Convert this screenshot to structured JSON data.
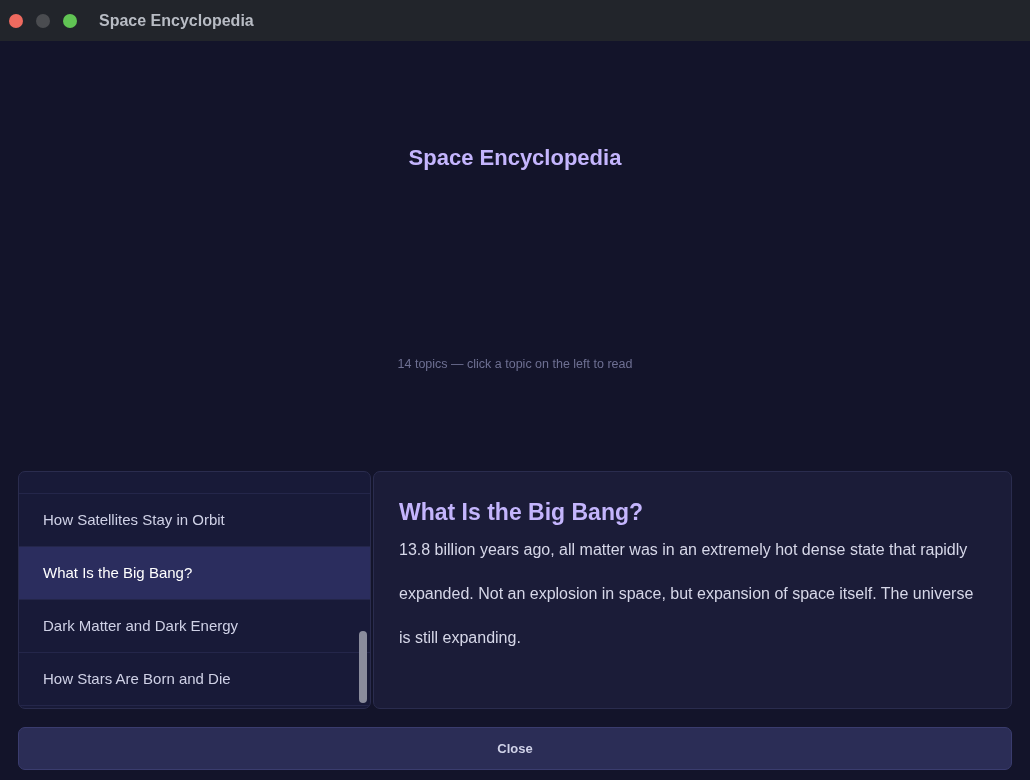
{
  "window": {
    "title": "Space Encyclopedia"
  },
  "heading": "Space Encyclopedia",
  "subtitle": "14 topics — click a topic on the left to read",
  "topics": [
    {
      "label": "How Satellites Stay in Orbit",
      "selected": false
    },
    {
      "label": "What Is the Big Bang?",
      "selected": true
    },
    {
      "label": "Dark Matter and Dark Energy",
      "selected": false
    },
    {
      "label": "How Stars Are Born and Die",
      "selected": false
    }
  ],
  "article": {
    "title": "What Is the Big Bang?",
    "body": "13.8 billion years ago, all matter was in an extremely hot dense state that rapidly expanded. Not an explosion in space, but expansion of space itself. The universe is still expanding."
  },
  "close_button": "Close"
}
